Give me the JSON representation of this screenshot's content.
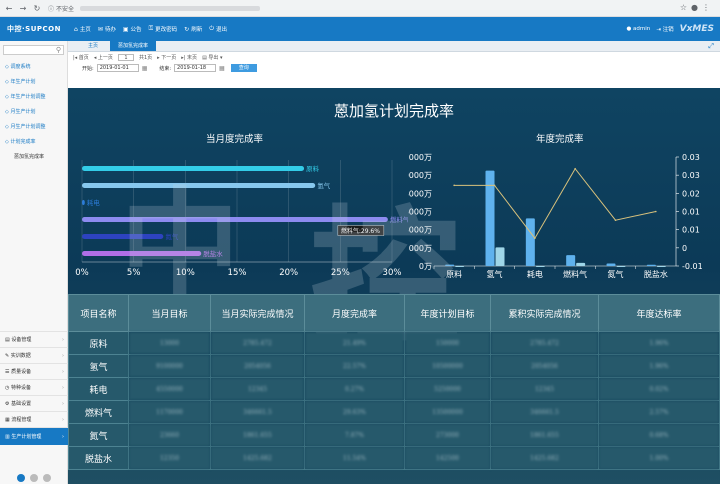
{
  "browser": {
    "security": "不安全"
  },
  "app": {
    "logo": "中控·SUPCON",
    "brand": "VxMES",
    "menu": [
      "主页",
      "待办",
      "公告",
      "更改密码",
      "刷新",
      "退出"
    ],
    "user": "admin",
    "logout": "注销"
  },
  "sidebar": {
    "items": [
      "调度系统",
      "年生产计划",
      "年生产计划调整",
      "月生产计划",
      "月生产计划调整",
      "计划完成率",
      "蒽加氢完成率"
    ],
    "bottom": [
      "设备管理",
      "实训数据",
      "质量设备",
      "特种设备",
      "基础设置",
      "流程管理",
      "生产计划管理"
    ]
  },
  "tabs": [
    "主页",
    "蒽加氢完成率"
  ],
  "pager": {
    "first": "首页",
    "prev": "上一页",
    "page": "1",
    "total": "共1页",
    "next": "下一页",
    "last": "末页",
    "export": "导出"
  },
  "filter": {
    "start_label": "开始:",
    "start_value": "2019-01-01",
    "end_label": "结束:",
    "end_value": "2019-01-18",
    "query": "查询"
  },
  "dashboard": {
    "title": "蒽加氢计划完成率",
    "left_title": "当月度完成率",
    "right_title": "年度完成率",
    "tooltip": "燃料气:29.6%"
  },
  "chart_data": [
    {
      "type": "bar",
      "orientation": "horizontal",
      "title": "当月度完成率",
      "categories": [
        "原料",
        "氢气",
        "耗电",
        "燃料气",
        "氮气",
        "脱盐水"
      ],
      "values": [
        21.49,
        22.57,
        0.27,
        29.6,
        7.87,
        11.54
      ],
      "xlim": [
        0,
        30
      ],
      "xticks": [
        "0%",
        "5%",
        "10%",
        "15%",
        "20%",
        "25%",
        "30%"
      ],
      "colors": [
        "#33cde8",
        "#87c8ee",
        "#2c7cd8",
        "#8d8bf0",
        "#2d43c0",
        "#b06ee8"
      ]
    },
    {
      "type": "bar+line",
      "title": "年度完成率",
      "categories": [
        "原料",
        "氢气",
        "耗电",
        "燃料气",
        "氮气",
        "脱盐水"
      ],
      "series": [
        {
          "type": "bar",
          "values": [
            150000,
            10500000,
            5250000,
            1200000,
            273000,
            142500
          ]
        },
        {
          "type": "bar",
          "values": [
            2785.472,
            2054056,
            1245,
            346661.5,
            1861.655,
            1425.682
          ]
        },
        {
          "type": "line",
          "axis": "right",
          "values": [
            0.0196,
            0.0196,
            0.0002,
            0.0257,
            0.0068,
            0.01
          ]
        }
      ],
      "yticks_left": [
        "0万",
        "2000万",
        "4000万",
        "6000万",
        "8000万",
        "10000万",
        "12000万"
      ],
      "yticks_right": [
        "-0.01",
        "0",
        "0.01",
        "0.01",
        "0.02",
        "0.03",
        "0.03"
      ],
      "ylim_left": [
        0,
        12000000
      ],
      "ylim_right": [
        -0.01,
        0.03
      ]
    }
  ],
  "table": {
    "headers": [
      "项目名称",
      "当月目标",
      "当月实际完成情况",
      "月度完成率",
      "年度计划目标",
      "累积实际完成情况",
      "年度达标率"
    ],
    "rows": [
      [
        "原料",
        "13000",
        "2785.472",
        "21.49%",
        "150000",
        "2785.472",
        "1.96%"
      ],
      [
        "氢气",
        "9100000",
        "2054056",
        "22.57%",
        "10500000",
        "2054056",
        "1.96%"
      ],
      [
        "耗电",
        "4550000",
        "12345",
        "0.27%",
        "5250000",
        "12345",
        "0.02%"
      ],
      [
        "燃料气",
        "1170000",
        "346661.5",
        "29.63%",
        "13500000",
        "346661.5",
        "2.57%"
      ],
      [
        "氮气",
        "23660",
        "1861.655",
        "7.87%",
        "273000",
        "1861.655",
        "0.68%"
      ],
      [
        "脱盐水",
        "12350",
        "1425.682",
        "11.54%",
        "142500",
        "1425.682",
        "1.00%"
      ]
    ]
  }
}
